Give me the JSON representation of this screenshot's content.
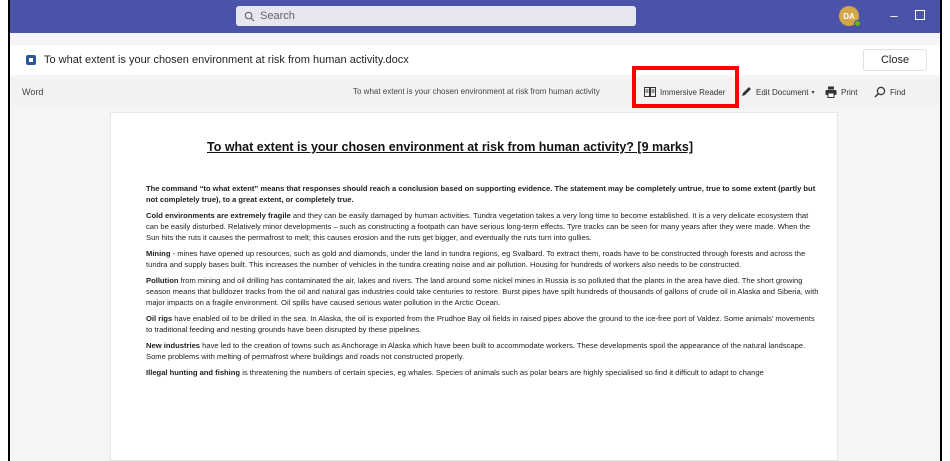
{
  "search": {
    "placeholder": "Search"
  },
  "user": {
    "initials": "DA"
  },
  "file": {
    "name": "To what extent is your chosen environment at risk from human activity.docx"
  },
  "buttons": {
    "close": "Close"
  },
  "ribbon": {
    "app_label": "Word",
    "doc_title": "To what extent is your chosen environment at risk from human activity",
    "immersive_reader": "Immersive Reader",
    "edit_document": "Edit Document",
    "print": "Print",
    "find": "Find"
  },
  "document": {
    "title": "To what extent is your chosen environment at risk from human activity? [9 marks]",
    "intro": "The command “to what extent” means that responses should reach a conclusion based on supporting evidence. The statement may be completely untrue, true to some extent (partly but not completely true), to a great extent, or completely true.",
    "paragraphs": [
      {
        "lead": "Cold environments are extremely fragile",
        "text": " and they can be easily damaged by human activities. Tundra vegetation takes a very long time to become established. It is a very delicate ecosystem that can be easily disturbed. Relatively minor developments – such as constructing a footpath can have serious long-term effects. Tyre tracks can be seen for many years after they were made. When the Sun hits the ruts it causes the permafrost to melt; this causes erosion and the ruts get bigger, and eventually the ruts turn into gullies."
      },
      {
        "lead": "Mining",
        "text": " - mines have opened up resources, such as gold and diamonds, under the land in tundra regions, eg Svalbard. To extract them, roads have to be constructed through forests and across the tundra and supply bases built. This increases the number of vehicles in the tundra creating noise and air pollution. Housing for hundreds of workers also needs to be constructed."
      },
      {
        "lead": "Pollution",
        "text": " from mining and oil drilling has contaminated the air, lakes and rivers. The land around some nickel mines in Russia is so polluted that the plants in the area have died. The short growing season means that bulldozer tracks from the oil and natural gas industries could take centuries to restore. Burst pipes have spilt hundreds of thousands of gallons of crude oil in Alaska and Siberia, with major impacts on a fragile environment. Oil spills have caused serious water pollution in the Arctic Ocean."
      },
      {
        "lead": "Oil rigs",
        "text": " have enabled oil to be drilled in the sea. In Alaska, the oil is exported from the Prudhoe Bay oil fields in raised pipes above the ground to the ice-free port of Valdez. Some animals' movements to traditional feeding and nesting grounds have been disrupted by these pipelines."
      },
      {
        "lead": "New industries",
        "text": " have led to the creation of towns such as Anchorage in Alaska which have been built to accommodate workers. These developments spoil the appearance of the natural landscape. Some problems with melting of permafrost where buildings and roads not constructed properly."
      },
      {
        "lead": "Illegal hunting and fishing",
        "text": " is threatening the numbers of certain species, eg whales. Species of animals such as polar bears are highly specialised so find it difficult to adapt to change"
      }
    ]
  },
  "colors": {
    "titlebar": "#4b53a8",
    "highlight": "#ff0000",
    "avatar": "#d2a74a"
  }
}
